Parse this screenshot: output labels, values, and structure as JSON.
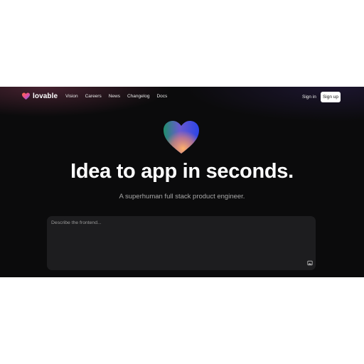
{
  "brand": {
    "name": "lovable",
    "logo_icon": "heart-logo-icon"
  },
  "nav": {
    "items": [
      {
        "label": "Vision"
      },
      {
        "label": "Careers"
      },
      {
        "label": "News"
      },
      {
        "label": "Changelog"
      },
      {
        "label": "Docs"
      }
    ],
    "sign_in": "Sign in",
    "sign_up": "Sign up"
  },
  "hero": {
    "icon": "heart-gradient-icon",
    "headline": "Idea to app in seconds.",
    "subheadline": "A superhuman full stack product engineer."
  },
  "prompt": {
    "placeholder": "Describe the frontend...",
    "value": "",
    "attach_icon": "image-icon"
  },
  "colors": {
    "background": "#0b0b0c",
    "prompt_box": "#1d1d1f",
    "text_primary": "#ffffff",
    "text_secondary": "#a7a7a7",
    "signup_bg": "#ffffff"
  }
}
